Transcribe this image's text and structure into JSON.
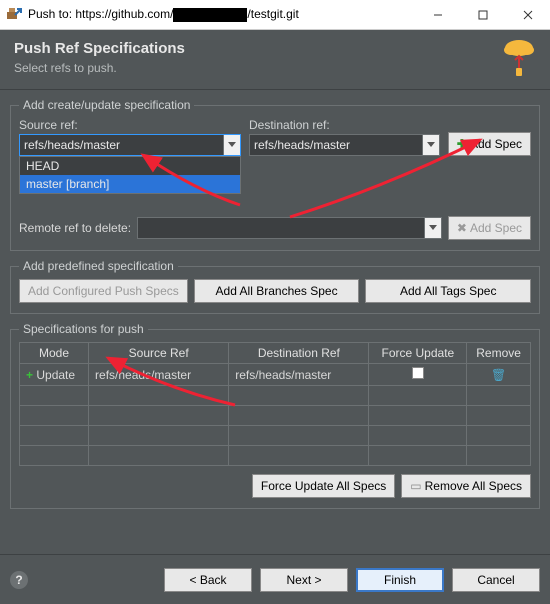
{
  "window": {
    "title_prefix": "Push to: https://github.com/",
    "title_suffix": "/testgit.git"
  },
  "header": {
    "title": "Push Ref Specifications",
    "subtitle": "Select refs to push."
  },
  "createSpec": {
    "legend": "Add create/update specification",
    "sourceLabel": "Source ref:",
    "sourceValue": "refs/heads/master",
    "destLabel": "Destination ref:",
    "destValue": "refs/heads/master",
    "addSpecLabel": "Add Spec",
    "options": [
      "HEAD",
      "master [branch]"
    ],
    "deleteLabel": "Remote ref to delete:",
    "deleteValue": "",
    "addSpecDisabledLabel": "Add Spec"
  },
  "predef": {
    "legend": "Add predefined specification",
    "btn1": "Add Configured Push Specs",
    "btn2": "Add All Branches Spec",
    "btn3": "Add All Tags Spec"
  },
  "specTable": {
    "legend": "Specifications for push",
    "headers": [
      "Mode",
      "Source Ref",
      "Destination Ref",
      "Force Update",
      "Remove"
    ],
    "rows": [
      {
        "mode": "Update",
        "src": "refs/heads/master",
        "dst": "refs/heads/master"
      }
    ],
    "forceAll": "Force Update All Specs",
    "removeAll": "Remove All Specs"
  },
  "footer": {
    "back": "< Back",
    "next": "Next >",
    "finish": "Finish",
    "cancel": "Cancel"
  }
}
